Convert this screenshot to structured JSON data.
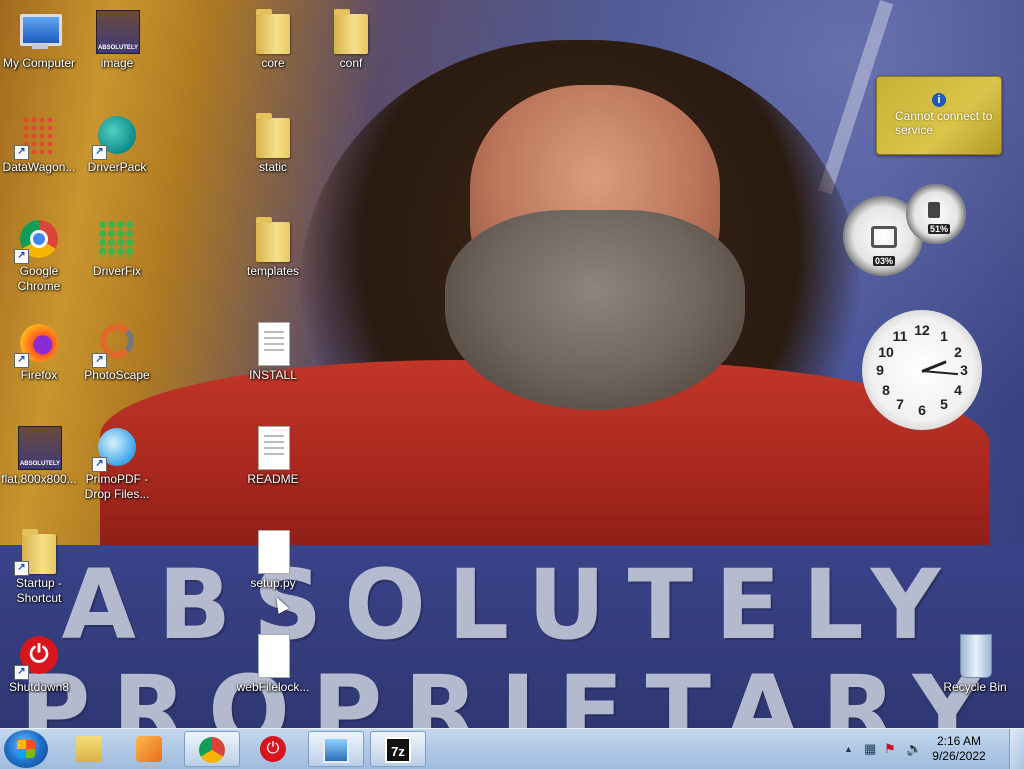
{
  "desktop": {
    "wallpaper_banner": [
      "ABSOLUTELY",
      "PROPRIETARY"
    ],
    "icons": [
      {
        "label": "My Computer",
        "icon": "computer-icon"
      },
      {
        "label": "image",
        "icon": "image-icon"
      },
      {
        "label": "core",
        "icon": "folder-icon"
      },
      {
        "label": "conf",
        "icon": "folder-icon"
      },
      {
        "label": "DataWagon...",
        "icon": "datawagon-icon"
      },
      {
        "label": "DriverPack",
        "icon": "driverpack-icon"
      },
      {
        "label": "static",
        "icon": "folder-icon"
      },
      {
        "label": "Google Chrome",
        "icon": "chrome-icon"
      },
      {
        "label": "DriverFix",
        "icon": "driverfix-icon"
      },
      {
        "label": "templates",
        "icon": "folder-icon"
      },
      {
        "label": "Firefox",
        "icon": "firefox-icon"
      },
      {
        "label": "PhotoScape",
        "icon": "photoscape-icon"
      },
      {
        "label": "INSTALL",
        "icon": "document-icon"
      },
      {
        "label": "flat,800x800...",
        "icon": "image-icon"
      },
      {
        "label": "PrimoPDF - Drop Files...",
        "icon": "primopdf-icon"
      },
      {
        "label": "README",
        "icon": "document-icon"
      },
      {
        "label": "Startup - Shortcut",
        "icon": "folder-shortcut-icon"
      },
      {
        "label": "setup.py",
        "icon": "file-icon"
      },
      {
        "label": "Shutdown8",
        "icon": "power-icon"
      },
      {
        "label": "webFilelock...",
        "icon": "file-icon"
      },
      {
        "label": "Recycle Bin",
        "icon": "recycle-bin-icon"
      }
    ]
  },
  "gadgets": {
    "weather": {
      "message": "Cannot connect to service",
      "icon": "info-icon"
    },
    "cpu_meter": {
      "cpu": "03%",
      "memory": "51%"
    },
    "clock": {
      "numbers": [
        "12",
        "1",
        "2",
        "3",
        "4",
        "5",
        "6",
        "7",
        "8",
        "9",
        "10",
        "11"
      ]
    }
  },
  "taskbar": {
    "start": "start-icon",
    "pinned": [
      "explorer-icon",
      "media-player-icon",
      "chrome-icon",
      "shutdown-icon",
      "image-viewer-icon",
      "7zip-icon"
    ],
    "sevenzip_label": "7z",
    "time": "2:16 AM",
    "date": "9/26/2022"
  }
}
